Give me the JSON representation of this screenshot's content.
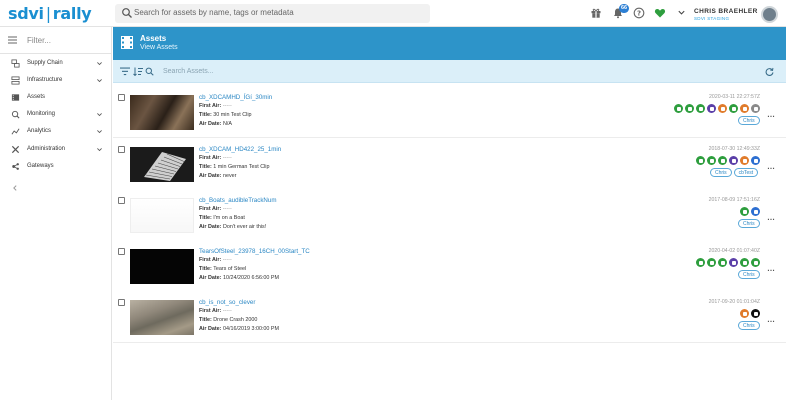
{
  "app": {
    "logo_left": "sdvi",
    "logo_sep": "|",
    "logo_right": "rally",
    "search_placeholder": "Search for assets by name, tags or metadata",
    "notifications_count": "66",
    "user_name": "CHRIS BRAEHLER",
    "user_org": "SDVI STAGING"
  },
  "sidebar": {
    "filter_placeholder": "Filter...",
    "items": [
      {
        "label": "Supply Chain",
        "icon": "supply-chain-icon",
        "has_chevron": true
      },
      {
        "label": "Infrastructure",
        "icon": "infrastructure-icon",
        "has_chevron": true
      },
      {
        "label": "Assets",
        "icon": "assets-icon",
        "has_chevron": false
      },
      {
        "label": "Monitoring",
        "icon": "monitoring-icon",
        "has_chevron": true
      },
      {
        "label": "Analytics",
        "icon": "analytics-icon",
        "has_chevron": true
      },
      {
        "label": "Administration",
        "icon": "administration-icon",
        "has_chevron": true
      },
      {
        "label": "Gateways",
        "icon": "gateways-icon",
        "has_chevron": false
      }
    ]
  },
  "header": {
    "title": "Assets",
    "subtitle": "View Assets"
  },
  "toolbar": {
    "search_placeholder": "Search Assets..."
  },
  "labels": {
    "first_air": "First Air:",
    "title": "Title:",
    "air_date": "Air Date:",
    "empty": "-----"
  },
  "colors": {
    "accent": "#2d94c9",
    "link": "#2a87c4",
    "green": "#2e9e3e",
    "purple": "#5b3fa8",
    "orange": "#e07b2b",
    "blue": "#2d6fd1",
    "gray": "#8a8a8a",
    "black": "#111111"
  },
  "assets": [
    {
      "name": "cb_XDCAMHD_ÍGí_30min",
      "first_air": "-----",
      "title": "30 min Test Clip",
      "air_date": "N/A",
      "date": "2020-03-11 22:27:57Z",
      "status_icons": [
        "green",
        "green",
        "green",
        "purple",
        "orange",
        "green",
        "orange",
        "gray"
      ],
      "tags": [
        "Chris"
      ],
      "thumb": "dark-cabin"
    },
    {
      "name": "cb_XDCAM_HD422_25_1min",
      "first_air": "-----",
      "title": "1 min German Test Clip",
      "air_date": "never",
      "date": "2018-07-30 12:49:33Z",
      "status_icons": [
        "green",
        "green",
        "green",
        "purple",
        "orange",
        "blue"
      ],
      "tags": [
        "Chris",
        "cbTest"
      ],
      "thumb": "keyboard"
    },
    {
      "name": "cb_Boats_audibleTrackNum",
      "first_air": "-----",
      "title": "I'm on a Boat",
      "air_date": "Don't ever air this!",
      "date": "2017-08-09 17:51:16Z",
      "status_icons": [
        "green",
        "blue"
      ],
      "tags": [
        "Chris"
      ],
      "thumb": "white"
    },
    {
      "name": "TearsOfSteel_23978_16CH_00Start_TC",
      "first_air": "-----",
      "title": "Tears of Steel",
      "air_date": "10/24/2020 6:56:00 PM",
      "date": "2020-04-02 01:07:40Z",
      "status_icons": [
        "green",
        "green",
        "green",
        "purple",
        "green",
        "green"
      ],
      "tags": [
        "Chris"
      ],
      "thumb": "black"
    },
    {
      "name": "cb_is_not_so_clever",
      "first_air": "-----",
      "title": "Drone Crash 2000",
      "air_date": "04/16/2019 3:00:00 PM",
      "date": "2017-09-20 01:01:04Z",
      "status_icons": [
        "orange",
        "black"
      ],
      "tags": [
        "Chris"
      ],
      "thumb": "path"
    }
  ]
}
